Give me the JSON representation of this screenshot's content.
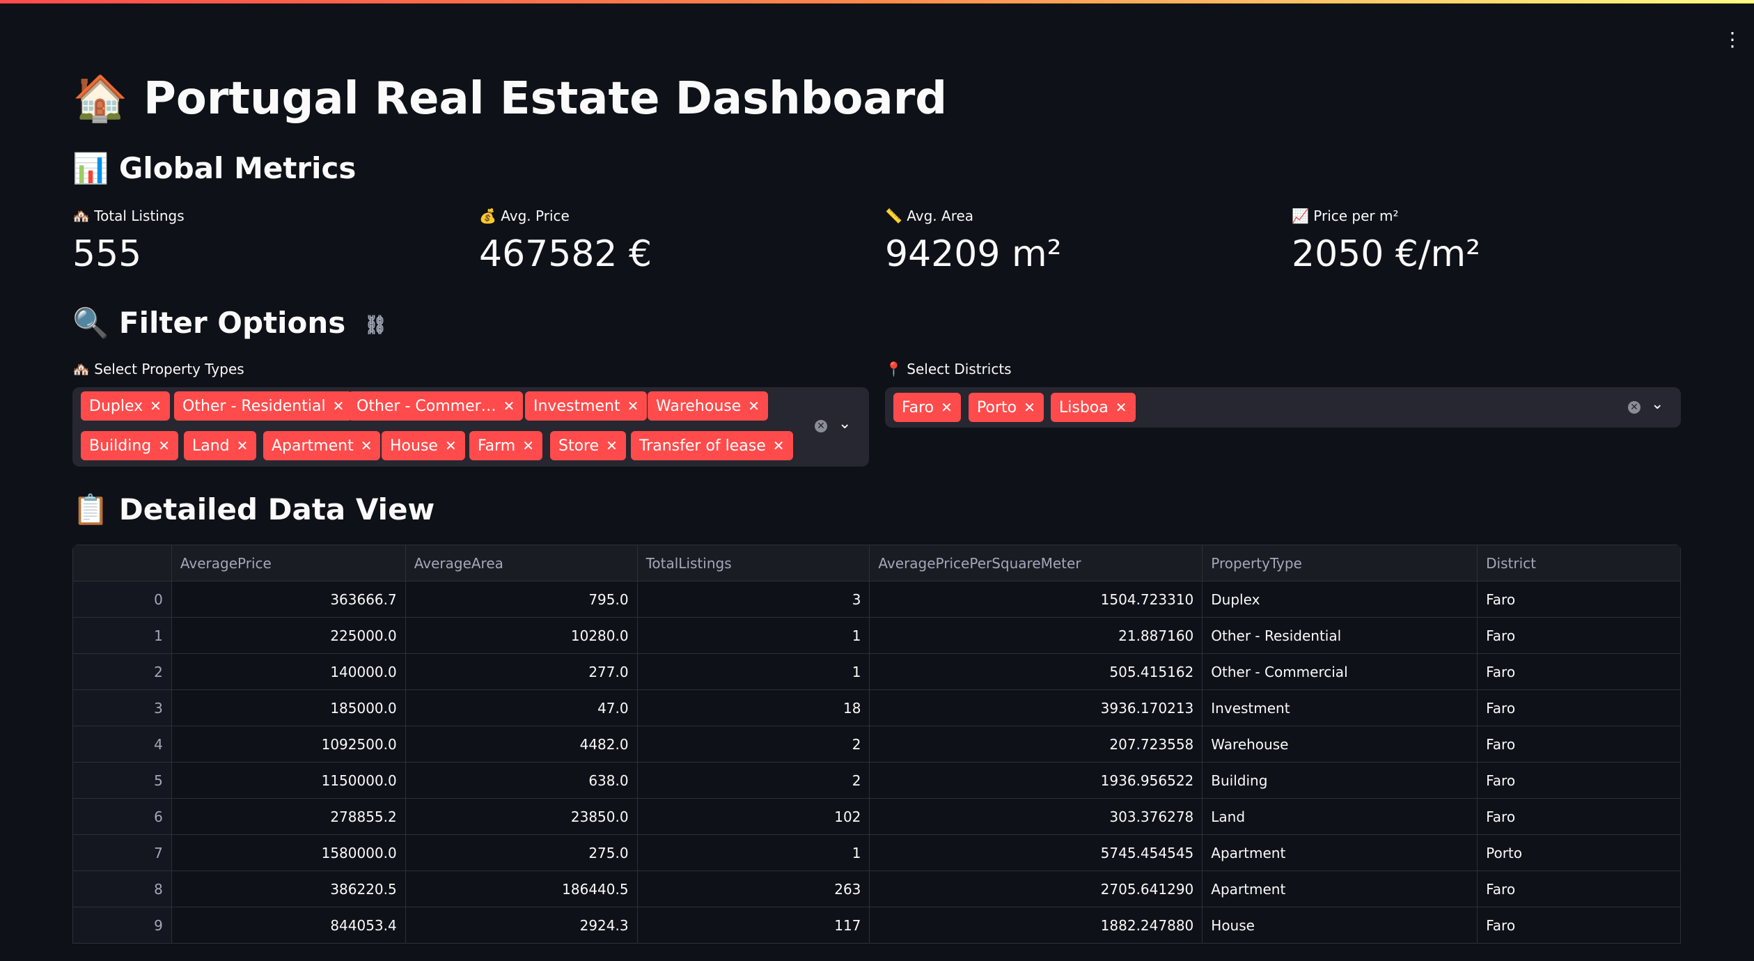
{
  "app": {
    "title_icon": "🏠",
    "title": "Portugal Real Estate Dashboard",
    "menu_icon": "vertical-ellipsis-icon"
  },
  "global_metrics": {
    "heading_icon": "📊",
    "heading": "Global Metrics",
    "metrics": [
      {
        "icon": "🏘️",
        "label": "Total Listings",
        "value": "555"
      },
      {
        "icon": "💰",
        "label": "Avg. Price",
        "value": "467582 €"
      },
      {
        "icon": "📏",
        "label": "Avg. Area",
        "value": "94209 m²"
      },
      {
        "icon": "📈",
        "label": "Price per m²",
        "value": "2050 €/m²"
      }
    ]
  },
  "filters": {
    "heading_icon": "🔍",
    "heading": "Filter Options",
    "property_types": {
      "label_icon": "🏘️",
      "label": "Select Property Types",
      "selected": [
        "Duplex",
        "Other - Residential",
        "Other - Commer…",
        "Investment",
        "Warehouse",
        "Building",
        "Land",
        "Apartment",
        "House",
        "Farm",
        "Store",
        "Transfer of lease"
      ]
    },
    "districts": {
      "label_icon": "📍",
      "label": "Select Districts",
      "selected": [
        "Faro",
        "Porto",
        "Lisboa"
      ]
    },
    "accent_color": "#ff4b4b"
  },
  "data_view": {
    "heading_icon": "📋",
    "heading": "Detailed Data View",
    "columns": [
      "",
      "AveragePrice",
      "AverageArea",
      "TotalListings",
      "AveragePricePerSquareMeter",
      "PropertyType",
      "District"
    ],
    "rows": [
      [
        "0",
        "363666.7",
        "795.0",
        "3",
        "1504.723310",
        "Duplex",
        "Faro"
      ],
      [
        "1",
        "225000.0",
        "10280.0",
        "1",
        "21.887160",
        "Other - Residential",
        "Faro"
      ],
      [
        "2",
        "140000.0",
        "277.0",
        "1",
        "505.415162",
        "Other - Commercial",
        "Faro"
      ],
      [
        "3",
        "185000.0",
        "47.0",
        "18",
        "3936.170213",
        "Investment",
        "Faro"
      ],
      [
        "4",
        "1092500.0",
        "4482.0",
        "2",
        "207.723558",
        "Warehouse",
        "Faro"
      ],
      [
        "5",
        "1150000.0",
        "638.0",
        "2",
        "1936.956522",
        "Building",
        "Faro"
      ],
      [
        "6",
        "278855.2",
        "23850.0",
        "102",
        "303.376278",
        "Land",
        "Faro"
      ],
      [
        "7",
        "1580000.0",
        "275.0",
        "1",
        "5745.454545",
        "Apartment",
        "Porto"
      ],
      [
        "8",
        "386220.5",
        "186440.5",
        "263",
        "2705.641290",
        "Apartment",
        "Faro"
      ],
      [
        "9",
        "844053.4",
        "2924.3",
        "117",
        "1882.247880",
        "House",
        "Faro"
      ]
    ]
  }
}
